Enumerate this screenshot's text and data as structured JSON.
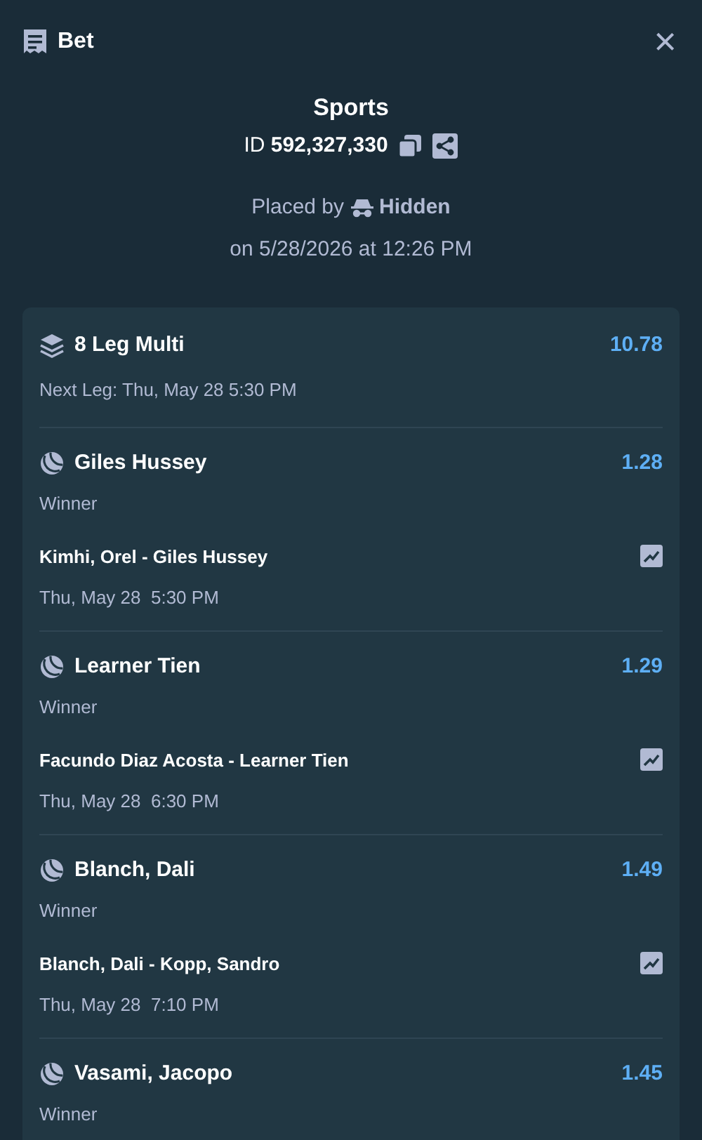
{
  "header": {
    "title": "Bet",
    "close": "×"
  },
  "summary": {
    "category": "Sports",
    "id_label": "ID",
    "id_value": "592,327,330",
    "placed_by_label": "Placed by",
    "placed_by_user": "Hidden",
    "placed_on": "on 5/28/2026 at 12:26 PM"
  },
  "multi": {
    "title": "8 Leg Multi",
    "odds": "10.78",
    "next_leg": "Next Leg: Thu, May 28 5:30 PM"
  },
  "legs": [
    {
      "selection": "Giles Hussey",
      "odds": "1.28",
      "market": "Winner",
      "match": "Kimhi, Orel - Giles Hussey",
      "time": "Thu, May 28  5:30 PM"
    },
    {
      "selection": "Learner Tien",
      "odds": "1.29",
      "market": "Winner",
      "match": "Facundo Diaz Acosta - Learner Tien",
      "time": "Thu, May 28  6:30 PM"
    },
    {
      "selection": "Blanch, Dali",
      "odds": "1.49",
      "market": "Winner",
      "match": "Blanch, Dali - Kopp, Sandro",
      "time": "Thu, May 28  7:10 PM"
    },
    {
      "selection": "Vasami, Jacopo",
      "odds": "1.45",
      "market": "Winner"
    }
  ]
}
